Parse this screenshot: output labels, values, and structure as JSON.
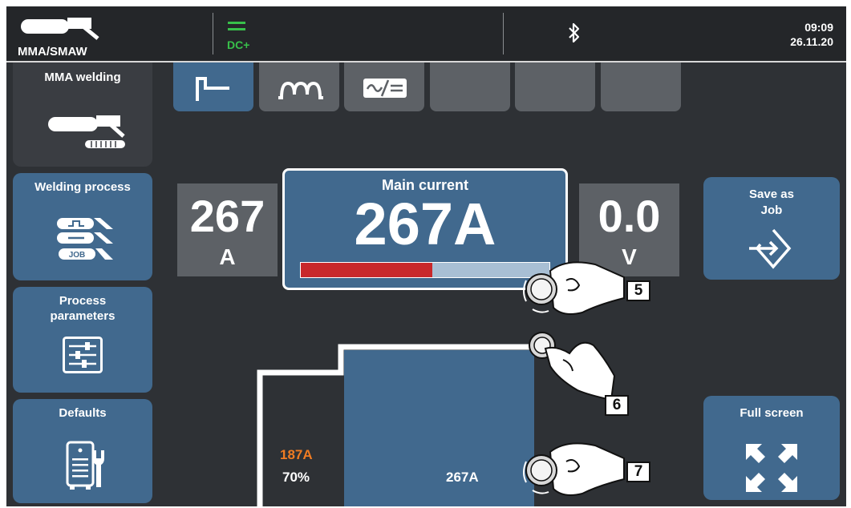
{
  "header": {
    "process": "MMA/SMAW",
    "polarity": "DC+",
    "time": "09:09",
    "date": "26.11.20",
    "icons": [
      "electrode-holder-icon",
      "dc-icon",
      "bluetooth-icon"
    ]
  },
  "sidebar": {
    "current_mode": "MMA welding",
    "items": [
      {
        "label": "Welding process",
        "icon": "process-job-icon"
      },
      {
        "label": "Process\nparameters",
        "icon": "sliders-icon"
      },
      {
        "label": "Defaults",
        "icon": "machine-wrench-icon"
      }
    ]
  },
  "tabs": [
    {
      "icon": "step-characteristic-icon",
      "active": true
    },
    {
      "icon": "pulse-icon",
      "active": false
    },
    {
      "icon": "ac-dc-icon",
      "active": false
    },
    {
      "icon": "",
      "active": false
    },
    {
      "icon": "",
      "active": false
    },
    {
      "icon": "",
      "active": false
    }
  ],
  "values": {
    "amps": "267",
    "amps_unit": "A",
    "volts": "0.0",
    "volts_unit": "V",
    "main_title": "Main current",
    "main_value": "267A",
    "main_bar_fraction": 0.53
  },
  "actions": {
    "save_job": "Save as\nJob",
    "full_screen": "Full screen"
  },
  "graph": {
    "start_current": "187A",
    "start_percent": "70%",
    "main_current": "267A"
  },
  "markers": [
    "5",
    "6",
    "7"
  ],
  "colors": {
    "accent_blue": "#41698e",
    "bar_red": "#c8282b",
    "polarity_green": "#38c04a",
    "start_orange": "#f07c22"
  }
}
